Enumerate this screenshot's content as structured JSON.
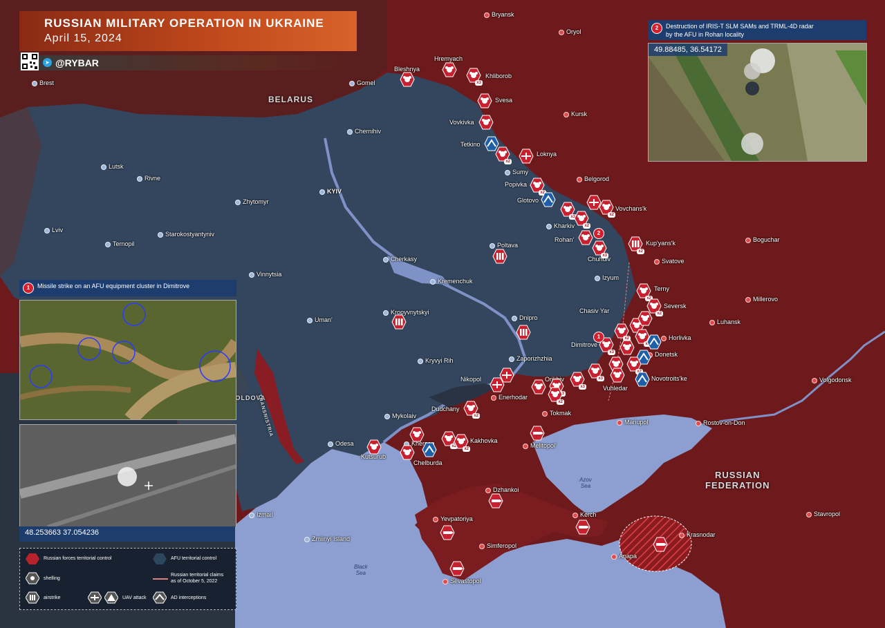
{
  "header": {
    "title": "RUSSIAN MILITARY OPERATION IN UKRAINE",
    "date": "April 15, 2024",
    "handle": "@RYBAR"
  },
  "panel1": {
    "number": "1",
    "caption": "Missile strike on an AFU equipment cluster in Dimitrove",
    "coords": "48.253663 37.054236"
  },
  "panel2": {
    "number": "2",
    "caption_line1": "Destruction of IRIS-T SLM SAMs and TRML-4D radar",
    "caption_line2": "by the AFU in Rohan locality",
    "coords": "49.88485, 36.54172"
  },
  "legend": {
    "russian_control": "Russian forces territorial control",
    "afu_control": "AFU territorial control",
    "shelling": "shelling",
    "claims_line1": "Russian territorial claims",
    "claims_line2": "as of October 5, 2022",
    "airstrike": "airstrike",
    "uav": "UAV attack",
    "ad": "AD interceptions"
  },
  "regions": {
    "belarus": "BELARUS",
    "russia_line1": "RUSSIAN",
    "russia_line2": "FEDERATION",
    "moldova": "MOLDOVA",
    "transnistria": "TRANSNISTRIA"
  },
  "seas": {
    "azov_line1": "Azov",
    "azov_line2": "Sea",
    "black_line1": "Black",
    "black_line2": "Sea"
  },
  "cities": [
    {
      "name": "Brest",
      "ru": false
    },
    {
      "name": "Gomel",
      "ru": false
    },
    {
      "name": "Chernihiv",
      "ru": false
    },
    {
      "name": "Lutsk",
      "ru": false
    },
    {
      "name": "Rivne",
      "ru": false
    },
    {
      "name": "Zhytomyr",
      "ru": false
    },
    {
      "name": "KYIV",
      "ru": false
    },
    {
      "name": "Lviv",
      "ru": false
    },
    {
      "name": "Ternopil",
      "ru": false
    },
    {
      "name": "Starokostyantyniv",
      "ru": false
    },
    {
      "name": "Vinnytsia",
      "ru": false
    },
    {
      "name": "Cherkasy",
      "ru": false
    },
    {
      "name": "Kremenchuk",
      "ru": false
    },
    {
      "name": "Uman'",
      "ru": false
    },
    {
      "name": "Kropyvnytskyi",
      "ru": false
    },
    {
      "name": "Kryvyi Rih",
      "ru": false
    },
    {
      "name": "Dnipro",
      "ru": false
    },
    {
      "name": "Zaporizhzhia",
      "ru": false
    },
    {
      "name": "Poltava",
      "ru": false
    },
    {
      "name": "Sumy",
      "ru": false
    },
    {
      "name": "Kharkiv",
      "ru": false
    },
    {
      "name": "Izyum",
      "ru": false
    },
    {
      "name": "Mykolaiv",
      "ru": false
    },
    {
      "name": "Odesa",
      "ru": false
    },
    {
      "name": "Izmail",
      "ru": false
    },
    {
      "name": "Zmiinyi Island",
      "ru": false
    },
    {
      "name": "Bryansk",
      "ru": true
    },
    {
      "name": "Oryol",
      "ru": true
    },
    {
      "name": "Kursk",
      "ru": true
    },
    {
      "name": "Belgorod",
      "ru": true
    },
    {
      "name": "Boguchar",
      "ru": true
    },
    {
      "name": "Millerovo",
      "ru": true
    },
    {
      "name": "Volgodonsk",
      "ru": true
    },
    {
      "name": "Rostov-on-Don",
      "ru": true
    },
    {
      "name": "Stavropol",
      "ru": true
    },
    {
      "name": "Krasnodar",
      "ru": true
    },
    {
      "name": "Anapa",
      "ru": true
    },
    {
      "name": "Kerch",
      "ru": true
    },
    {
      "name": "Simferopol",
      "ru": true
    },
    {
      "name": "Yevpatoriya",
      "ru": true
    },
    {
      "name": "Sevastopol",
      "ru": true
    },
    {
      "name": "Dzhankoi",
      "ru": true
    },
    {
      "name": "Melitopol'",
      "ru": true
    },
    {
      "name": "Mariupol",
      "ru": true
    },
    {
      "name": "Luhansk",
      "ru": true
    },
    {
      "name": "Donetsk",
      "ru": true
    },
    {
      "name": "Horlivka",
      "ru": true
    },
    {
      "name": "Svatove",
      "ru": true
    },
    {
      "name": "Tokmak",
      "ru": true
    },
    {
      "name": "Enerhodar",
      "ru": true
    },
    {
      "name": "Kherson",
      "ru": false
    }
  ],
  "frontline_labels": [
    "Bleshnya",
    "Hremyach",
    "Khliborob",
    "Svesa",
    "Vovkivka",
    "Tetkino",
    "Loknya",
    "Popivka",
    "Glotovo",
    "Vovchans'k",
    "Rohan'",
    "Chuhuiv",
    "Kup'yans'k",
    "Terny",
    "Seversk",
    "Chasiv Yar",
    "Dimitrove",
    "Novotroits'ke",
    "Vuhledar",
    "Orikhiv",
    "Nikopol",
    "Dudchany",
    "Kakhovka",
    "Chelburda",
    "Kutsurub"
  ],
  "markers": [
    {
      "type": "shelling",
      "badge": ""
    },
    {
      "type": "shelling",
      "badge": "x2"
    },
    {
      "type": "shelling",
      "badge": "x3"
    },
    {
      "type": "airstrike",
      "badge": ""
    },
    {
      "type": "airstrike",
      "badge": "x2"
    },
    {
      "type": "uav",
      "badge": ""
    },
    {
      "type": "ad",
      "badge": ""
    },
    {
      "type": "missile",
      "badge": ""
    }
  ]
}
